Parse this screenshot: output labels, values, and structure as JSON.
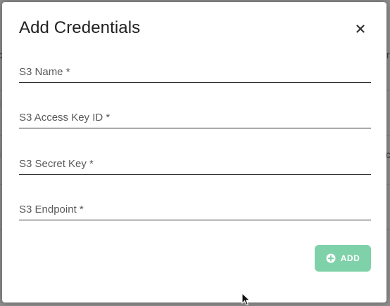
{
  "modal": {
    "title": "Add Credentials",
    "close_icon": "close-icon",
    "fields": [
      {
        "placeholder": "S3 Name *",
        "value": ""
      },
      {
        "placeholder": "S3 Access Key ID *",
        "value": ""
      },
      {
        "placeholder": "S3 Secret Key *",
        "value": ""
      },
      {
        "placeholder": "S3 Endpoint *",
        "value": ""
      }
    ],
    "add_button": {
      "label": "ADD",
      "icon": "plus-circle-icon",
      "color": "#7fd1a9"
    }
  },
  "background_fragments": [
    "c",
    "i",
    "i",
    "r",
    "c"
  ],
  "colors": {
    "overlay": "#8e8e8e",
    "modal_bg": "#ffffff",
    "accent": "#7fd1a9"
  }
}
